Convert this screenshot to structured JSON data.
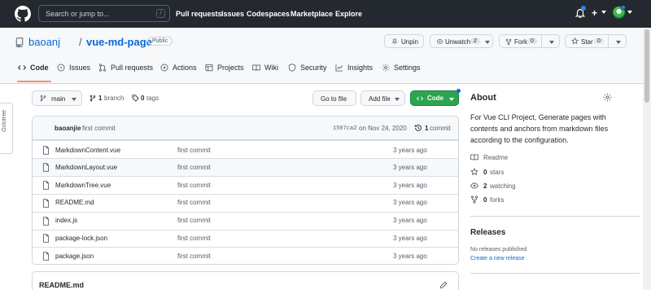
{
  "topnav": {
    "search_placeholder": "Search or jump to...",
    "search_shortcut": "/",
    "links": [
      "Pull requests",
      "Issues",
      "Codespaces",
      "Marketplace",
      "Explore"
    ],
    "plus": "+"
  },
  "repo": {
    "owner": "baoanj",
    "separator": "/",
    "name": "vue-md-page",
    "visibility": "Public"
  },
  "actions": {
    "unpin": "Unpin",
    "unwatch": "Unwatch",
    "watch_count": "2",
    "fork": "Fork",
    "fork_count": "0",
    "star": "Star",
    "star_count": "0"
  },
  "tabs": [
    "Code",
    "Issues",
    "Pull requests",
    "Actions",
    "Projects",
    "Wiki",
    "Security",
    "Insights",
    "Settings"
  ],
  "toolbar": {
    "branch": "main",
    "branches_count": "1",
    "branches_label": "branch",
    "tags_count": "0",
    "tags_label": "tags",
    "go_to_file": "Go to file",
    "add_file": "Add file",
    "code": "Code"
  },
  "commit": {
    "author": "baoanjie",
    "message": "first commit",
    "sha": "1507ca2",
    "date": "on Nov 24, 2020",
    "count": "1",
    "count_label": "commit"
  },
  "files": [
    {
      "name": "MarkdownContent.vue",
      "message": "first commit",
      "age": "3 years ago"
    },
    {
      "name": "MarkdownLayout.vue",
      "message": "first commit",
      "age": "3 years ago"
    },
    {
      "name": "MarkdownTree.vue",
      "message": "first commit",
      "age": "3 years ago"
    },
    {
      "name": "README.md",
      "message": "first commit",
      "age": "3 years ago"
    },
    {
      "name": "index.js",
      "message": "first commit",
      "age": "3 years ago"
    },
    {
      "name": "package-lock.json",
      "message": "first commit",
      "age": "3 years ago"
    },
    {
      "name": "package.json",
      "message": "first commit",
      "age": "3 years ago"
    }
  ],
  "readme": {
    "title": "README.md"
  },
  "about": {
    "title": "About",
    "description": "For Vue CLI Project, Generate pages with contents and anchors from markdown files according to the configuration.",
    "readme": "Readme",
    "stars_count": "0",
    "stars_label": "stars",
    "watching_count": "2",
    "watching_label": "watching",
    "forks_count": "0",
    "forks_label": "forks"
  },
  "releases": {
    "title": "Releases",
    "none": "No releases published",
    "create": "Create a new release"
  },
  "octotree": {
    "label": "Octotree"
  },
  "colors": {
    "accent": "#0969da",
    "green": "#2da44e",
    "topbar": "#24292f",
    "tab_underline": "#fd8c73"
  }
}
